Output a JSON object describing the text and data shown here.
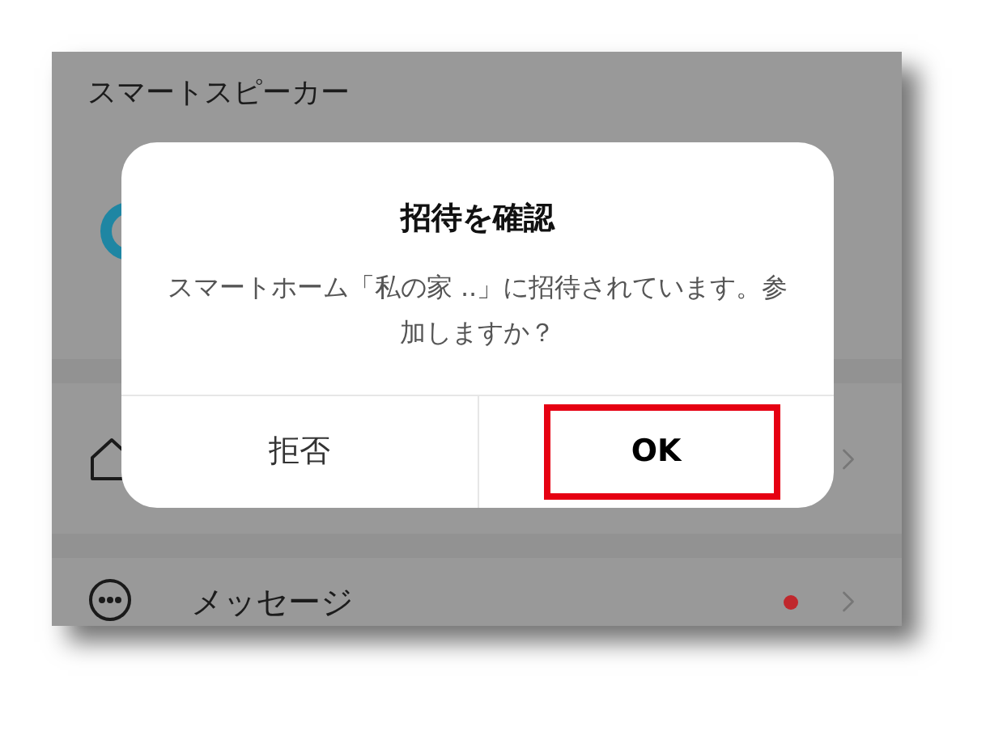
{
  "screen": {
    "title": "スマートスピーカー",
    "rows": [
      {
        "kind": "avatar"
      },
      {
        "kind": "home",
        "chevron": true
      },
      {
        "kind": "message",
        "label": "メッセージ",
        "unread": true,
        "chevron": true
      }
    ]
  },
  "dialog": {
    "title": "招待を確認",
    "message": "スマートホーム「私の家 ..」に招待されています。参加しますか？",
    "buttons": [
      {
        "label": "拒否",
        "primary": false,
        "highlighted": false
      },
      {
        "label": "OK",
        "primary": true,
        "highlighted": true
      }
    ]
  }
}
